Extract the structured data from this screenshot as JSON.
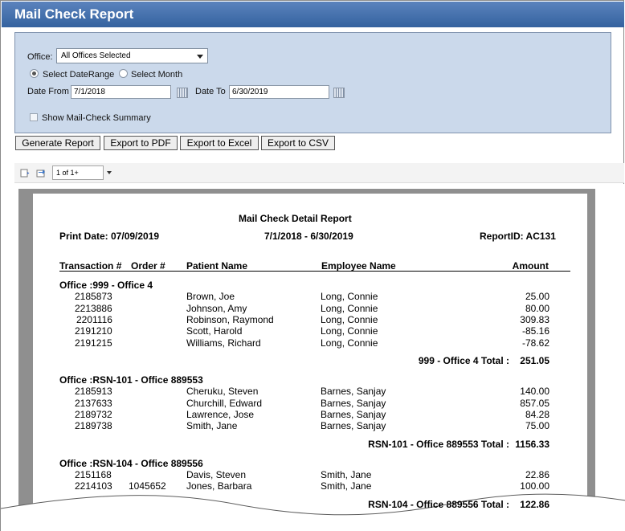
{
  "app": {
    "title": "Mail Check Report"
  },
  "filters": {
    "office_label": "Office:",
    "office_value": "All Offices Selected",
    "range_options": [
      "Select DateRange",
      "Select Month"
    ],
    "date_from_label": "Date From",
    "date_from_value": "7/1/2018",
    "date_to_label": "Date To",
    "date_to_value": "6/30/2019",
    "summary_label": "Show Mail-Check Summary"
  },
  "actions": {
    "generate": "Generate Report",
    "pdf": "Export to PDF",
    "excel": "Export to Excel",
    "csv": "Export to CSV"
  },
  "toolbar": {
    "page_value": "1 of 1+"
  },
  "report": {
    "title": "Mail Check Detail Report",
    "print_date": "Print Date: 07/09/2019",
    "range": "7/1/2018 - 6/30/2019",
    "report_id": "ReportID: AC131",
    "columns": [
      "Transaction #",
      "Order #",
      "Patient Name",
      "Employee Name",
      "Amount"
    ],
    "groups": [
      {
        "header": "Office :999 - Office 4",
        "rows": [
          [
            "2185873",
            "",
            "Brown, Joe",
            "Long, Connie",
            "25.00"
          ],
          [
            "2213886",
            "",
            "Johnson, Amy",
            "Long, Connie",
            "80.00"
          ],
          [
            "2201116",
            "",
            "Robinson, Raymond",
            "Long, Connie",
            "309.83"
          ],
          [
            "2191210",
            "",
            "Scott, Harold",
            "Long, Connie",
            "-85.16"
          ],
          [
            "2191215",
            "",
            "Williams, Richard",
            "Long, Connie",
            "-78.62"
          ]
        ],
        "total_label": "999 - Office 4 Total :",
        "total_value": "251.05"
      },
      {
        "header": "Office :RSN-101 - Office 889553",
        "rows": [
          [
            "2185913",
            "",
            "Cheruku, Steven",
            "Barnes, Sanjay",
            "140.00"
          ],
          [
            "2137633",
            "",
            "Churchill, Edward",
            "Barnes, Sanjay",
            "857.05"
          ],
          [
            "2189732",
            "",
            "Lawrence, Jose",
            "Barnes, Sanjay",
            "84.28"
          ],
          [
            "2189738",
            "",
            "Smith, Jane",
            "Barnes, Sanjay",
            "75.00"
          ]
        ],
        "total_label": "RSN-101 - Office 889553 Total :",
        "total_value": "1156.33"
      },
      {
        "header": "Office :RSN-104 - Office 889556",
        "rows": [
          [
            "2151168",
            "",
            "Davis, Steven",
            "Smith, Jane",
            "22.86"
          ],
          [
            "2214103",
            "1045652",
            "Jones, Barbara",
            "Smith, Jane",
            "100.00"
          ]
        ],
        "total_label": "RSN-104 - Office 889556 Total :",
        "total_value": "122.86"
      }
    ]
  }
}
